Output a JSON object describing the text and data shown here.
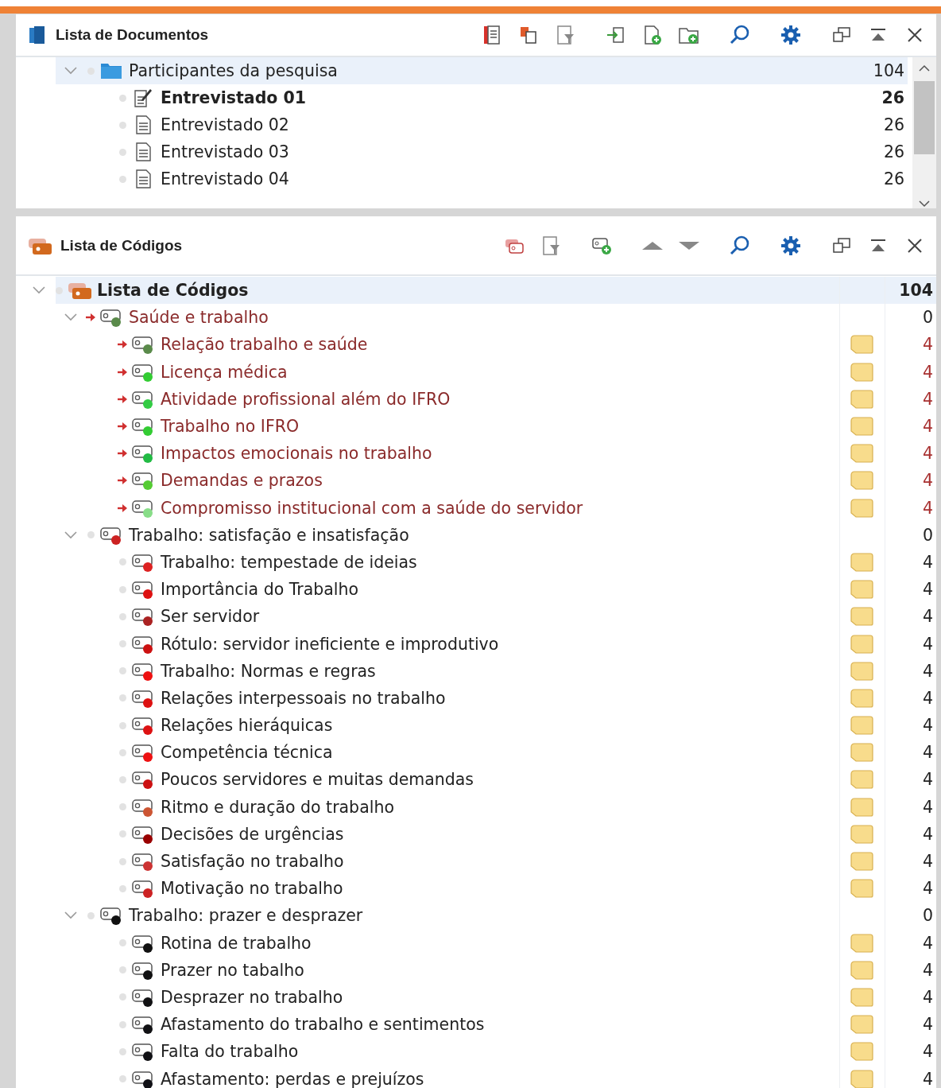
{
  "documents": {
    "title": "Lista de Documentos",
    "toolbar": [
      {
        "kind": "docs"
      },
      {
        "kind": "copy"
      },
      {
        "kind": "filter"
      },
      {
        "kind": "import"
      },
      {
        "kind": "new-doc"
      },
      {
        "kind": "new-folder"
      },
      {
        "kind": "search"
      },
      {
        "kind": "settings"
      },
      {
        "kind": "undock"
      },
      {
        "kind": "collapse"
      },
      {
        "kind": "close"
      }
    ],
    "folders": [
      {
        "name": "Participantes da pesquisa",
        "count": "104",
        "expanded": true,
        "selected": true,
        "children": [
          {
            "name": "Entrevistado 01",
            "count": "26",
            "kind": "edited",
            "active": true,
            "selected": false
          },
          {
            "name": "Entrevistado 02",
            "count": "26",
            "kind": "text",
            "active": false,
            "selected": false
          },
          {
            "name": "Entrevistado 03",
            "count": "26",
            "kind": "text",
            "active": false,
            "selected": false
          },
          {
            "name": "Entrevistado 04",
            "count": "26",
            "kind": "text",
            "active": false,
            "selected": false
          }
        ]
      }
    ]
  },
  "codes": {
    "title": "Lista de Códigos",
    "toolbar": [
      {
        "kind": "codes"
      },
      {
        "kind": "filter"
      },
      {
        "kind": "new-code"
      },
      {
        "kind": "up"
      },
      {
        "kind": "down"
      },
      {
        "kind": "search"
      },
      {
        "kind": "settings"
      },
      {
        "kind": "undock"
      },
      {
        "kind": "collapse"
      },
      {
        "kind": "close"
      }
    ],
    "root": {
      "name": "Lista de Códigos",
      "count": "104",
      "expanded": true,
      "selected": true,
      "children": [
        {
          "name": "Saúde e trabalho",
          "count": "0",
          "color": "#5a8a4a",
          "linked": true,
          "memo": false,
          "expanded": true,
          "selected": false,
          "children": [
            {
              "name": "Relação trabalho e saúde",
              "count": "4",
              "color": "#5a8a4a",
              "linked": true,
              "memo": true,
              "selected": false
            },
            {
              "name": "Licença médica",
              "count": "4",
              "color": "#33cc33",
              "linked": true,
              "memo": true,
              "selected": false
            },
            {
              "name": "Atividade profissional além do IFRO",
              "count": "4",
              "color": "#33cc44",
              "linked": true,
              "memo": true,
              "selected": false
            },
            {
              "name": "Trabalho no IFRO",
              "count": "4",
              "color": "#33cc33",
              "linked": true,
              "memo": true,
              "selected": false
            },
            {
              "name": "Impactos emocionais no trabalho",
              "count": "4",
              "color": "#22bb44",
              "linked": true,
              "memo": true,
              "selected": false
            },
            {
              "name": "Demandas e prazos",
              "count": "4",
              "color": "#55cc33",
              "linked": true,
              "memo": true,
              "selected": false
            },
            {
              "name": "Compromisso institucional com a saúde do servidor",
              "count": "4",
              "color": "#88dd88",
              "linked": true,
              "memo": true,
              "selected": false
            }
          ]
        },
        {
          "name": "Trabalho: satisfação e insatisfação",
          "count": "0",
          "color": "#cc2222",
          "linked": false,
          "memo": false,
          "expanded": true,
          "selected": false,
          "children": [
            {
              "name": "Trabalho: tempestade de ideias",
              "count": "4",
              "color": "#dd2222",
              "linked": false,
              "memo": true,
              "selected": false
            },
            {
              "name": "Importância do Trabalho",
              "count": "4",
              "color": "#dd1111",
              "linked": false,
              "memo": true,
              "selected": false
            },
            {
              "name": "Ser servidor",
              "count": "4",
              "color": "#aa2222",
              "linked": false,
              "memo": true,
              "selected": false
            },
            {
              "name": "Rótulo: servidor ineficiente e improdutivo",
              "count": "4",
              "color": "#cc1111",
              "linked": false,
              "memo": true,
              "selected": false
            },
            {
              "name": "Trabalho: Normas e regras",
              "count": "4",
              "color": "#ee1111",
              "linked": false,
              "memo": true,
              "selected": false
            },
            {
              "name": "Relações interpessoais no trabalho",
              "count": "4",
              "color": "#dd1111",
              "linked": false,
              "memo": true,
              "selected": false
            },
            {
              "name": "Relações hieráquicas",
              "count": "4",
              "color": "#dd1112",
              "linked": false,
              "memo": true,
              "selected": false
            },
            {
              "name": "Competência técnica",
              "count": "4",
              "color": "#ee1112",
              "linked": false,
              "memo": true,
              "selected": false
            },
            {
              "name": "Poucos servidores e muitas demandas",
              "count": "4",
              "color": "#cc1112",
              "linked": false,
              "memo": true,
              "selected": false
            },
            {
              "name": "Ritmo e duração do trabalho",
              "count": "4",
              "color": "#cc5533",
              "linked": false,
              "memo": true,
              "selected": false
            },
            {
              "name": "Decisões de urgências",
              "count": "4",
              "color": "#990000",
              "linked": false,
              "memo": true,
              "selected": false
            },
            {
              "name": "Satisfação no trabalho",
              "count": "4",
              "color": "#cc3333",
              "linked": false,
              "memo": true,
              "selected": false
            },
            {
              "name": "Motivação no trabalho",
              "count": "4",
              "color": "#cc2223",
              "linked": false,
              "memo": true,
              "selected": false
            }
          ]
        },
        {
          "name": "Trabalho: prazer e desprazer",
          "count": "0",
          "color": "#111111",
          "linked": false,
          "memo": false,
          "expanded": true,
          "selected": false,
          "children": [
            {
              "name": "Rotina de trabalho",
              "count": "4",
              "color": "#111111",
              "linked": false,
              "memo": true,
              "selected": false
            },
            {
              "name": "Prazer no tabalho",
              "count": "4",
              "color": "#111112",
              "linked": false,
              "memo": true,
              "selected": false
            },
            {
              "name": "Desprazer no trabalho",
              "count": "4",
              "color": "#111113",
              "linked": false,
              "memo": true,
              "selected": false
            },
            {
              "name": "Afastamento do trabalho e sentimentos",
              "count": "4",
              "color": "#111114",
              "linked": false,
              "memo": true,
              "selected": false
            },
            {
              "name": "Falta do trabalho",
              "count": "4",
              "color": "#111115",
              "linked": false,
              "memo": true,
              "selected": false
            },
            {
              "name": "Afastamento: perdas e prejuízos",
              "count": "4",
              "color": "#111116",
              "linked": false,
              "memo": true,
              "selected": false
            }
          ]
        }
      ]
    }
  }
}
